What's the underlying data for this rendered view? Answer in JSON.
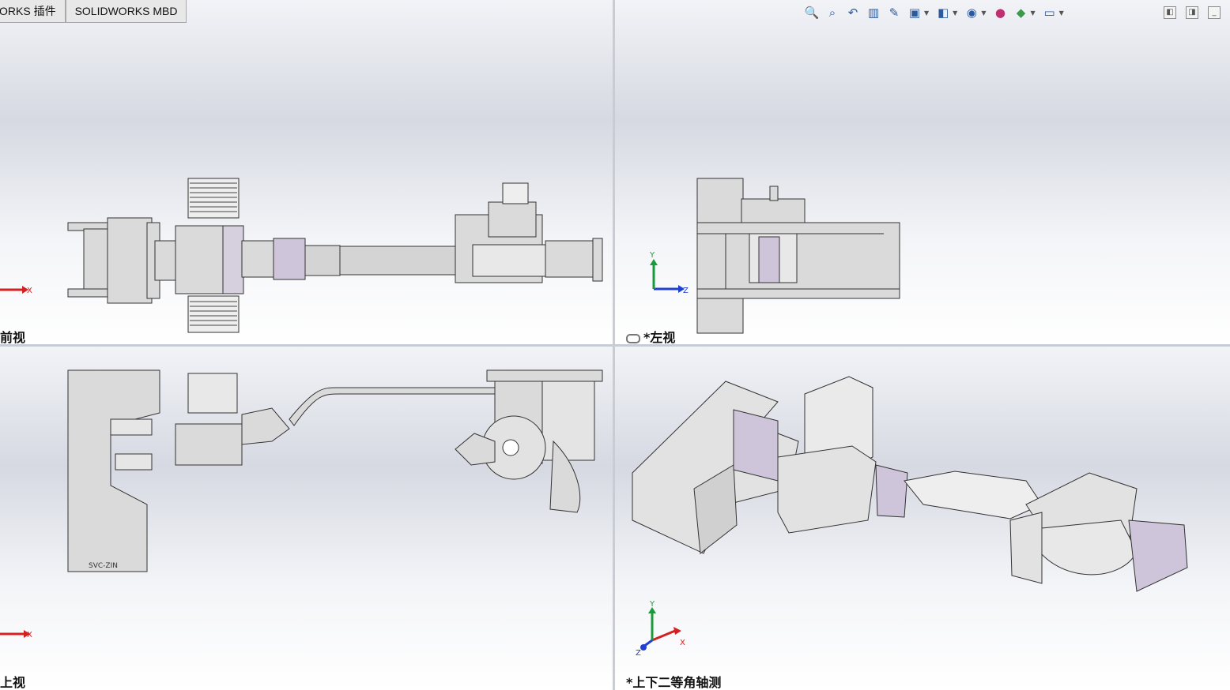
{
  "tabs": [
    {
      "label": "ORKS 插件"
    },
    {
      "label": "SOLIDWORKS MBD"
    }
  ],
  "viewports": {
    "top_left": {
      "label": "前视"
    },
    "top_right": {
      "label": "*左视"
    },
    "bottom_left": {
      "label": "上视"
    },
    "bottom_right": {
      "label": "*上下二等角轴测"
    }
  },
  "axes": {
    "x": "X",
    "y": "Y",
    "z": "Z"
  },
  "parts": {
    "stamp_text": "SVC-ZIN"
  },
  "hud_icons": [
    "zoom-to-fit-icon",
    "zoom-area-icon",
    "previous-view-icon",
    "section-view-icon",
    "dynamic-annotation-icon",
    "view-orientation-icon",
    "display-style-icon",
    "hide-show-icon",
    "edit-appearance-icon",
    "apply-scene-icon",
    "view-settings-icon"
  ],
  "colors": {
    "axis_x": "#d32020",
    "axis_y": "#1a9a3a",
    "axis_z": "#2040d0",
    "part_fill": "#d8d8d8",
    "part_accent": "#c9c0d6"
  }
}
